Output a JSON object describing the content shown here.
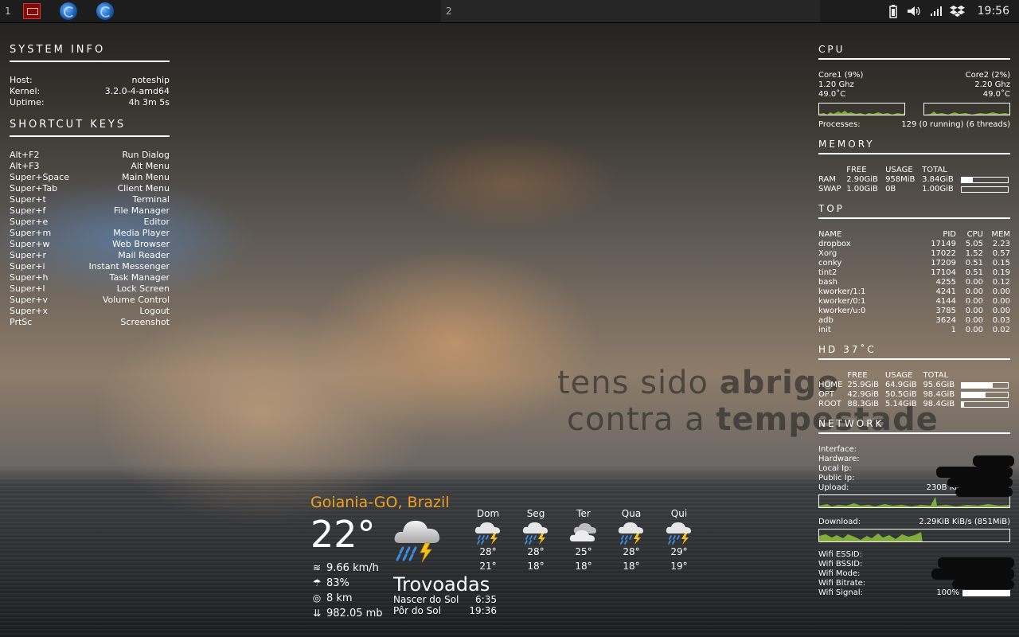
{
  "panel": {
    "workspace_1": "1",
    "workspace_2": "2",
    "clock": "19:56",
    "apps": [
      "terminal-icon",
      "firefox-icon",
      "firefox-icon"
    ],
    "tray": [
      "battery-icon",
      "volume-icon",
      "signal-icon",
      "dropbox-icon"
    ]
  },
  "tagline": {
    "line1_light": "tens sido ",
    "line1_bold": "abrigo",
    "line2_light": "contra a ",
    "line2_bold": "tempestade"
  },
  "system_info": {
    "title": "SYSTEM INFO",
    "rows": [
      {
        "k": "Host:",
        "v": "noteship"
      },
      {
        "k": "Kernel:",
        "v": "3.2.0-4-amd64"
      },
      {
        "k": "Uptime:",
        "v": "4h 3m 5s"
      }
    ]
  },
  "shortcuts": {
    "title": "SHORTCUT KEYS",
    "rows": [
      {
        "k": "Alt+F2",
        "v": "Run Dialog"
      },
      {
        "k": "Alt+F3",
        "v": "Alt Menu"
      },
      {
        "k": "Super+Space",
        "v": "Main Menu"
      },
      {
        "k": "Super+Tab",
        "v": "Client Menu"
      },
      {
        "k": "Super+t",
        "v": "Terminal"
      },
      {
        "k": "Super+f",
        "v": "File Manager"
      },
      {
        "k": "Super+e",
        "v": "Editor"
      },
      {
        "k": "Super+m",
        "v": "Media Player"
      },
      {
        "k": "Super+w",
        "v": "Web Browser"
      },
      {
        "k": "Super+r",
        "v": "Mail Reader"
      },
      {
        "k": "Super+i",
        "v": "Instant Messenger"
      },
      {
        "k": "Super+h",
        "v": "Task Manager"
      },
      {
        "k": "Super+l",
        "v": "Lock Screen"
      },
      {
        "k": "Super+v",
        "v": "Volume Control"
      },
      {
        "k": "Super+x",
        "v": "Logout"
      },
      {
        "k": "PrtSc",
        "v": "Screenshot"
      }
    ]
  },
  "cpu": {
    "title": "CPU",
    "core1": {
      "name": "Core1",
      "pct": "(9%)",
      "freq": "1.20 Ghz",
      "temp": "49.0˚C"
    },
    "core2": {
      "name": "Core2",
      "pct": "(2%)",
      "freq": "2.20 Ghz",
      "temp": "49.0˚C"
    },
    "processes_label": "Processes:",
    "processes_value": "129  (0 running)  (6 threads)"
  },
  "memory": {
    "title": "MEMORY",
    "headers": [
      "",
      "FREE",
      "USAGE",
      "TOTAL"
    ],
    "rows": [
      {
        "name": "RAM",
        "free": "2.90GiB",
        "usage": "958MiB",
        "total": "3.84GiB",
        "fill": 0.24
      },
      {
        "name": "SWAP",
        "free": "1.00GiB",
        "usage": "0B",
        "total": "1.00GiB",
        "fill": 0.0
      }
    ]
  },
  "top": {
    "title": "TOP",
    "headers": [
      "NAME",
      "PID",
      "CPU",
      "MEM"
    ],
    "rows": [
      [
        "dropbox",
        "17149",
        "5.05",
        "2.23"
      ],
      [
        "Xorg",
        "17022",
        "1.52",
        "0.57"
      ],
      [
        "conky",
        "17209",
        "0.51",
        "0.15"
      ],
      [
        "tint2",
        "17104",
        "0.51",
        "0.19"
      ],
      [
        "bash",
        "4255",
        "0.00",
        "0.12"
      ],
      [
        "kworker/1:1",
        "4241",
        "0.00",
        "0.00"
      ],
      [
        "kworker/0:1",
        "4144",
        "0.00",
        "0.00"
      ],
      [
        "kworker/u:0",
        "3785",
        "0.00",
        "0.00"
      ],
      [
        "adb",
        "3624",
        "0.00",
        "0.03"
      ],
      [
        "init",
        "1",
        "0.00",
        "0.02"
      ]
    ]
  },
  "hd": {
    "title": "HD  37˚C",
    "headers": [
      "",
      "FREE",
      "USAGE",
      "TOTAL"
    ],
    "rows": [
      {
        "name": "HOME",
        "free": "25.9GiB",
        "usage": "64.9GiB",
        "total": "95.6GiB",
        "fill": 0.68
      },
      {
        "name": "OPT",
        "free": "42.9GiB",
        "usage": "50.5GiB",
        "total": "98.4GiB",
        "fill": 0.51
      },
      {
        "name": "ROOT",
        "free": "88.3GiB",
        "usage": "5.14GiB",
        "total": "98.4GiB",
        "fill": 0.05
      }
    ]
  },
  "network": {
    "title": "NETWORK",
    "labels": [
      "Interface:",
      "Hardware:",
      "Local Ip:",
      "Public Ip:"
    ],
    "upload_label": "Upload:",
    "upload_value": "230B  KiB/s (37.0MiB)",
    "download_label": "Download:",
    "download_value": "2.29KiB KiB/s (851MiB)",
    "wifi_labels": [
      "Wifi ESSID:",
      "Wifi BSSID:",
      "Wifi Mode:",
      "Wifi Bitrate:"
    ],
    "signal_label": "Wifi Signal:",
    "signal_value": "100%",
    "signal_fill": 1.0
  },
  "weather": {
    "city": "Goiania-GO, Brazil",
    "temp": "22°",
    "icon": "thunderstorm-icon",
    "wind": "9.66 km/h",
    "humidity": "83%",
    "visibility": "8 km",
    "pressure": "982.05 mb",
    "condition": "Trovoadas",
    "sunrise_label": "Nascer do Sol",
    "sunrise": "6:35",
    "sunset_label": "Pôr do Sol",
    "sunset": "19:36",
    "forecast": [
      {
        "day": "Dom",
        "icon": "rain-thunder-icon",
        "high": "28°",
        "low": "21°"
      },
      {
        "day": "Seg",
        "icon": "rain-thunder-icon",
        "high": "28°",
        "low": "18°"
      },
      {
        "day": "Ter",
        "icon": "cloudy-icon",
        "high": "25°",
        "low": "18°"
      },
      {
        "day": "Qua",
        "icon": "rain-thunder-icon",
        "high": "28°",
        "low": "18°"
      },
      {
        "day": "Qui",
        "icon": "rain-thunder-icon",
        "high": "29°",
        "low": "19°"
      }
    ]
  }
}
